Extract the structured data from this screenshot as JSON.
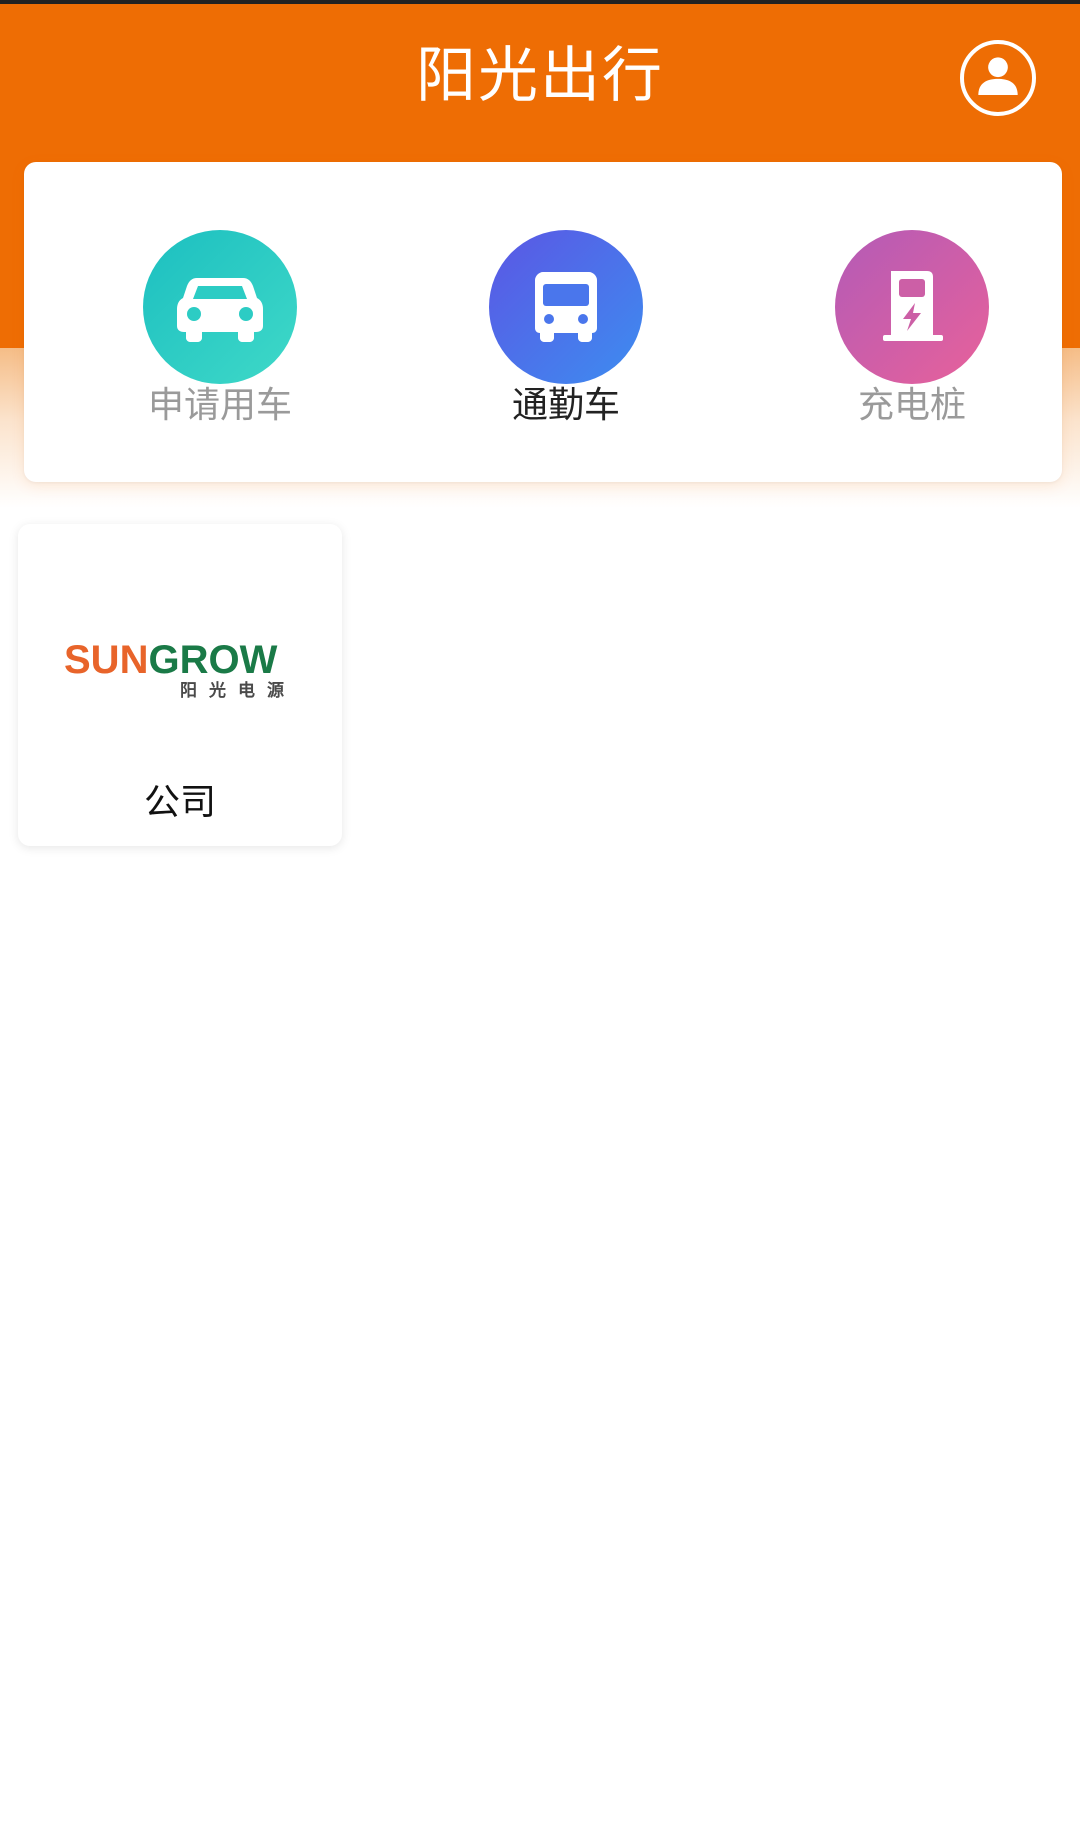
{
  "header": {
    "title": "阳光出行",
    "profile_icon": "user-avatar-icon"
  },
  "shortcuts": [
    {
      "label": "申请用车",
      "icon": "car-icon",
      "colors": [
        "#1cbfc0",
        "#3fd9c8"
      ],
      "active": false
    },
    {
      "label": "通勤车",
      "icon": "bus-icon",
      "colors": [
        "#5b56e4",
        "#3d8df0"
      ],
      "active": true
    },
    {
      "label": "充电桩",
      "icon": "charging-station-icon",
      "colors": [
        "#b35bb7",
        "#e8619a"
      ],
      "active": false
    }
  ],
  "companies": [
    {
      "logo": {
        "word_part1": "SUN",
        "word_part2": "GROW",
        "subtitle": "阳光电源"
      },
      "label": "公司"
    }
  ],
  "colors": {
    "brand_orange": "#ee6d04",
    "logo_orange": "#e8642a",
    "logo_green": "#1a7a47"
  }
}
